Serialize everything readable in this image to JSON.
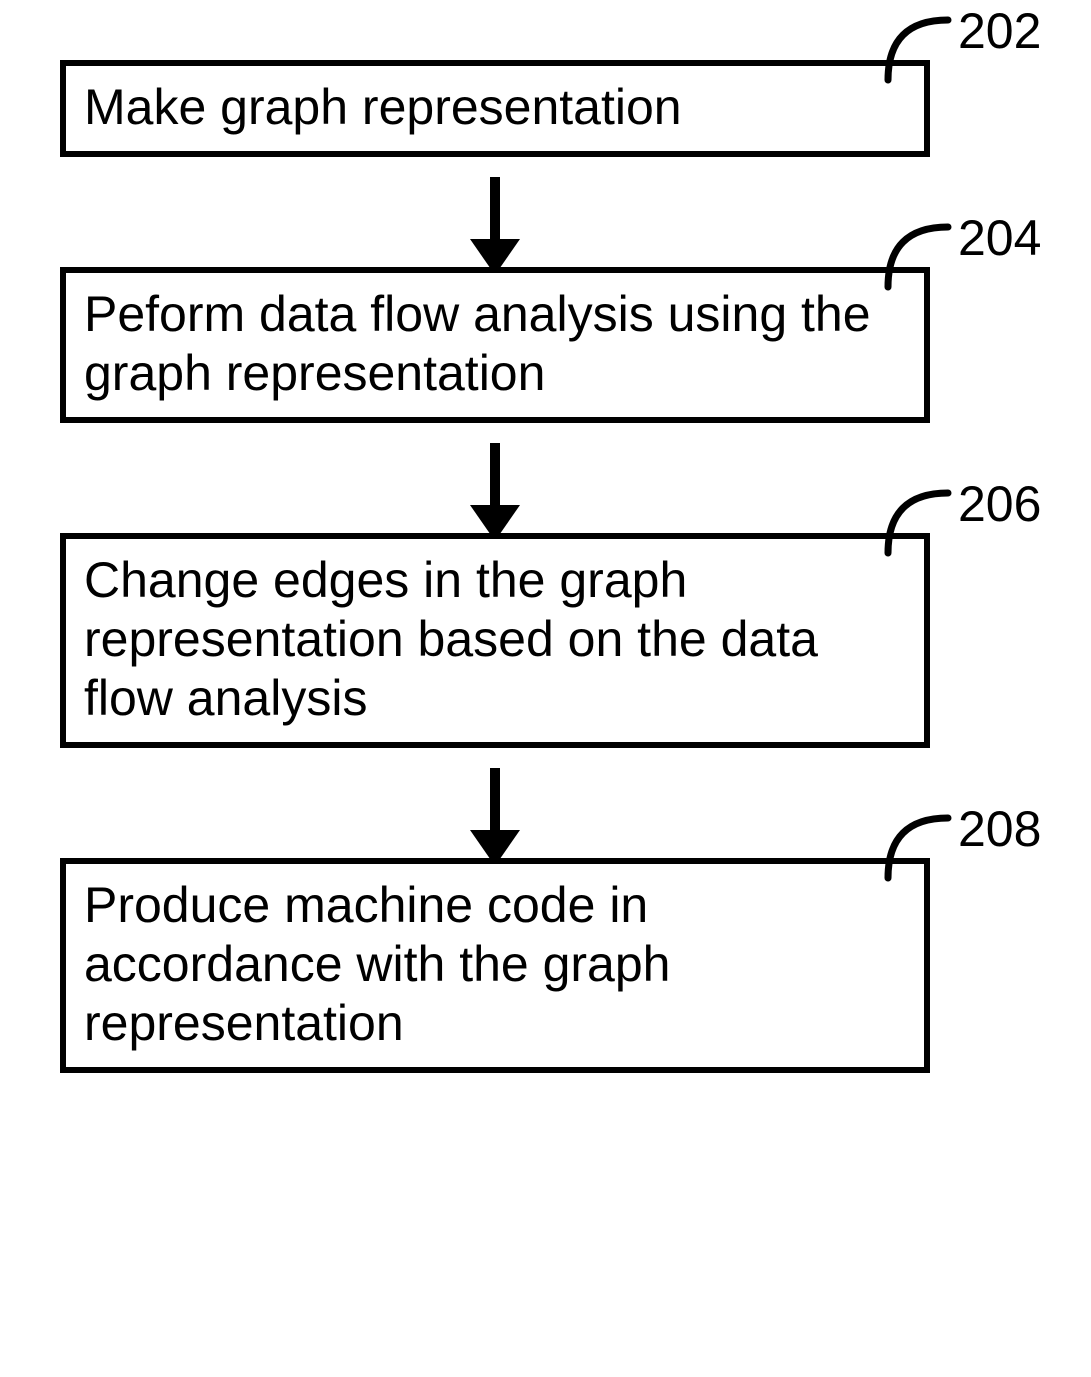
{
  "steps": [
    {
      "id": "202",
      "text": "Make graph representation"
    },
    {
      "id": "204",
      "text": "Peform data flow analysis using the graph representation"
    },
    {
      "id": "206",
      "text": "Change edges in the graph representation based on the data flow analysis"
    },
    {
      "id": "208",
      "text": "Produce machine code in accordance with the graph representation"
    }
  ]
}
